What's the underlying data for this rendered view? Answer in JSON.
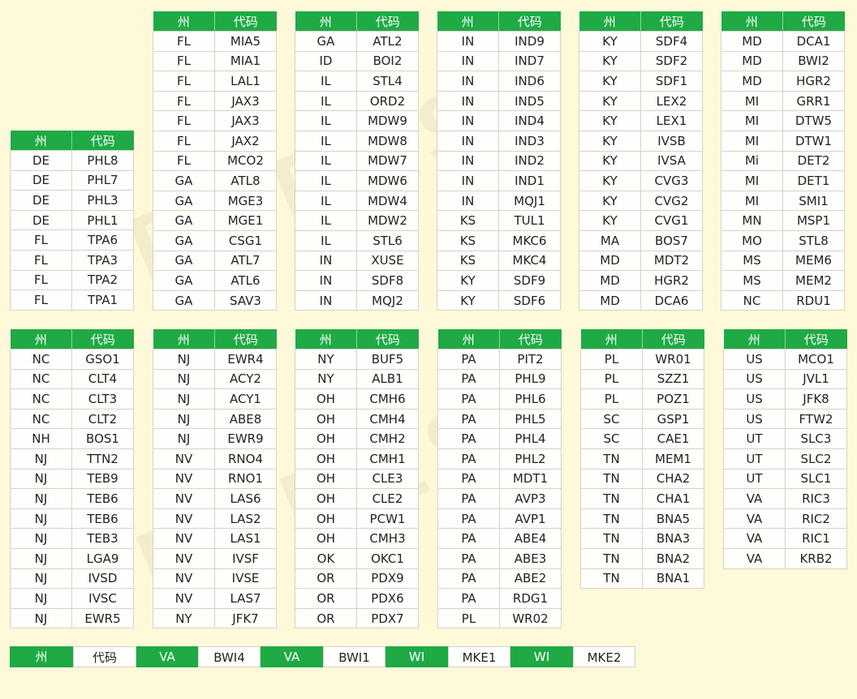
{
  "header": {
    "state": "州",
    "code": "代码"
  },
  "tables": [
    {
      "rows": [
        [
          "DE",
          "PHL8"
        ],
        [
          "DE",
          "PHL7"
        ],
        [
          "DE",
          "PHL3"
        ],
        [
          "DE",
          "PHL1"
        ],
        [
          "FL",
          "TPA6"
        ],
        [
          "FL",
          "TPA3"
        ],
        [
          "FL",
          "TPA2"
        ],
        [
          "FL",
          "TPA1"
        ]
      ]
    },
    {
      "rows": [
        [
          "FL",
          "MIA5"
        ],
        [
          "FL",
          "MIA1"
        ],
        [
          "FL",
          "LAL1"
        ],
        [
          "FL",
          "JAX3"
        ],
        [
          "FL",
          "JAX3"
        ],
        [
          "FL",
          "JAX2"
        ],
        [
          "FL",
          "MCO2"
        ],
        [
          "GA",
          "ATL8"
        ],
        [
          "GA",
          "MGE3"
        ],
        [
          "GA",
          "MGE1"
        ],
        [
          "GA",
          "CSG1"
        ],
        [
          "GA",
          "ATL7"
        ],
        [
          "GA",
          "ATL6"
        ],
        [
          "GA",
          "SAV3"
        ]
      ]
    },
    {
      "rows": [
        [
          "GA",
          "ATL2"
        ],
        [
          "ID",
          "BOI2"
        ],
        [
          "IL",
          "STL4"
        ],
        [
          "IL",
          "ORD2"
        ],
        [
          "IL",
          "MDW9"
        ],
        [
          "IL",
          "MDW8"
        ],
        [
          "IL",
          "MDW7"
        ],
        [
          "IL",
          "MDW6"
        ],
        [
          "IL",
          "MDW4"
        ],
        [
          "IL",
          "MDW2"
        ],
        [
          "IL",
          "STL6"
        ],
        [
          "IN",
          "XUSE"
        ],
        [
          "IN",
          "SDF8"
        ],
        [
          "IN",
          "MQJ2"
        ]
      ]
    },
    {
      "rows": [
        [
          "IN",
          "IND9"
        ],
        [
          "IN",
          "IND7"
        ],
        [
          "IN",
          "IND6"
        ],
        [
          "IN",
          "IND5"
        ],
        [
          "IN",
          "IND4"
        ],
        [
          "IN",
          "IND3"
        ],
        [
          "IN",
          "IND2"
        ],
        [
          "IN",
          "IND1"
        ],
        [
          "IN",
          "MQJ1"
        ],
        [
          "KS",
          "TUL1"
        ],
        [
          "KS",
          "MKC6"
        ],
        [
          "KS",
          "MKC4"
        ],
        [
          "KY",
          "SDF9"
        ],
        [
          "KY",
          "SDF6"
        ]
      ]
    },
    {
      "rows": [
        [
          "KY",
          "SDF4"
        ],
        [
          "KY",
          "SDF2"
        ],
        [
          "KY",
          "SDF1"
        ],
        [
          "KY",
          "LEX2"
        ],
        [
          "KY",
          "LEX1"
        ],
        [
          "KY",
          "IVSB"
        ],
        [
          "KY",
          "IVSA"
        ],
        [
          "KY",
          "CVG3"
        ],
        [
          "KY",
          "CVG2"
        ],
        [
          "KY",
          "CVG1"
        ],
        [
          "MA",
          "BOS7"
        ],
        [
          "MD",
          "MDT2"
        ],
        [
          "MD",
          "HGR2"
        ],
        [
          "MD",
          "DCA6"
        ]
      ]
    },
    {
      "rows": [
        [
          "MD",
          "DCA1"
        ],
        [
          "MD",
          "BWI2"
        ],
        [
          "MD",
          "HGR2"
        ],
        [
          "MI",
          "GRR1"
        ],
        [
          "MI",
          "DTW5"
        ],
        [
          "MI",
          "DTW1"
        ],
        [
          "Mi",
          "DET2"
        ],
        [
          "MI",
          "DET1"
        ],
        [
          "MI",
          "SMI1"
        ],
        [
          "MN",
          "MSP1"
        ],
        [
          "MO",
          "STL8"
        ],
        [
          "MS",
          "MEM6"
        ],
        [
          "MS",
          "MEM2"
        ],
        [
          "NC",
          "RDU1"
        ]
      ]
    },
    {
      "rows": [
        [
          "NC",
          "GSO1"
        ],
        [
          "NC",
          "CLT4"
        ],
        [
          "NC",
          "CLT3"
        ],
        [
          "NC",
          "CLT2"
        ],
        [
          "NH",
          "BOS1"
        ],
        [
          "NJ",
          "TTN2"
        ],
        [
          "NJ",
          "TEB9"
        ],
        [
          "NJ",
          "TEB6"
        ],
        [
          "NJ",
          "TEB6"
        ],
        [
          "NJ",
          "TEB3"
        ],
        [
          "NJ",
          "LGA9"
        ],
        [
          "NJ",
          "IVSD"
        ],
        [
          "NJ",
          "IVSC"
        ],
        [
          "NJ",
          "EWR5"
        ]
      ]
    },
    {
      "rows": [
        [
          "NJ",
          "EWR4"
        ],
        [
          "NJ",
          "ACY2"
        ],
        [
          "NJ",
          "ACY1"
        ],
        [
          "NJ",
          "ABE8"
        ],
        [
          "NJ",
          "EWR9"
        ],
        [
          "NV",
          "RNO4"
        ],
        [
          "NV",
          "RNO1"
        ],
        [
          "NV",
          "LAS6"
        ],
        [
          "NV",
          "LAS2"
        ],
        [
          "NV",
          "LAS1"
        ],
        [
          "NV",
          "IVSF"
        ],
        [
          "NV",
          "IVSE"
        ],
        [
          "NV",
          "LAS7"
        ],
        [
          "NY",
          "JFK7"
        ]
      ]
    },
    {
      "rows": [
        [
          "NY",
          "BUF5"
        ],
        [
          "NY",
          "ALB1"
        ],
        [
          "OH",
          "CMH6"
        ],
        [
          "OH",
          "CMH4"
        ],
        [
          "OH",
          "CMH2"
        ],
        [
          "OH",
          "CMH1"
        ],
        [
          "OH",
          "CLE3"
        ],
        [
          "OH",
          "CLE2"
        ],
        [
          "OH",
          "PCW1"
        ],
        [
          "OH",
          "CMH3"
        ],
        [
          "OK",
          "OKC1"
        ],
        [
          "OR",
          "PDX9"
        ],
        [
          "OR",
          "PDX6"
        ],
        [
          "OR",
          "PDX7"
        ]
      ]
    },
    {
      "rows": [
        [
          "PA",
          "PIT2"
        ],
        [
          "PA",
          "PHL9"
        ],
        [
          "PA",
          "PHL6"
        ],
        [
          "PA",
          "PHL5"
        ],
        [
          "PA",
          "PHL4"
        ],
        [
          "PA",
          "PHL2"
        ],
        [
          "PA",
          "MDT1"
        ],
        [
          "PA",
          "AVP3"
        ],
        [
          "PA",
          "AVP1"
        ],
        [
          "PA",
          "ABE4"
        ],
        [
          "PA",
          "ABE3"
        ],
        [
          "PA",
          "ABE2"
        ],
        [
          "PA",
          "RDG1"
        ],
        [
          "PL",
          "WR02"
        ]
      ]
    },
    {
      "rows": [
        [
          "PL",
          "WR01"
        ],
        [
          "PL",
          "SZZ1"
        ],
        [
          "PL",
          "POZ1"
        ],
        [
          "SC",
          "GSP1"
        ],
        [
          "SC",
          "CAE1"
        ],
        [
          "TN",
          "MEM1"
        ],
        [
          "TN",
          "CHA2"
        ],
        [
          "TN",
          "CHA1"
        ],
        [
          "TN",
          "BNA5"
        ],
        [
          "TN",
          "BNA3"
        ],
        [
          "TN",
          "BNA2"
        ],
        [
          "TN",
          "BNA1"
        ]
      ]
    },
    {
      "rows": [
        [
          "US",
          "MCO1"
        ],
        [
          "US",
          "JVL1"
        ],
        [
          "US",
          "JFK8"
        ],
        [
          "US",
          "FTW2"
        ],
        [
          "UT",
          "SLC3"
        ],
        [
          "UT",
          "SLC2"
        ],
        [
          "UT",
          "SLC1"
        ],
        [
          "VA",
          "RIC3"
        ],
        [
          "VA",
          "RIC2"
        ],
        [
          "VA",
          "RIC1"
        ],
        [
          "VA",
          "KRB2"
        ]
      ]
    }
  ],
  "bottom_strip": [
    "州",
    "代码",
    "VA",
    "BWI4",
    "VA",
    "BWI1",
    "WI",
    "MKE1",
    "WI",
    "MKE2"
  ],
  "colors": {
    "header_green": "#1faa45",
    "background": "#fdf9d9"
  }
}
